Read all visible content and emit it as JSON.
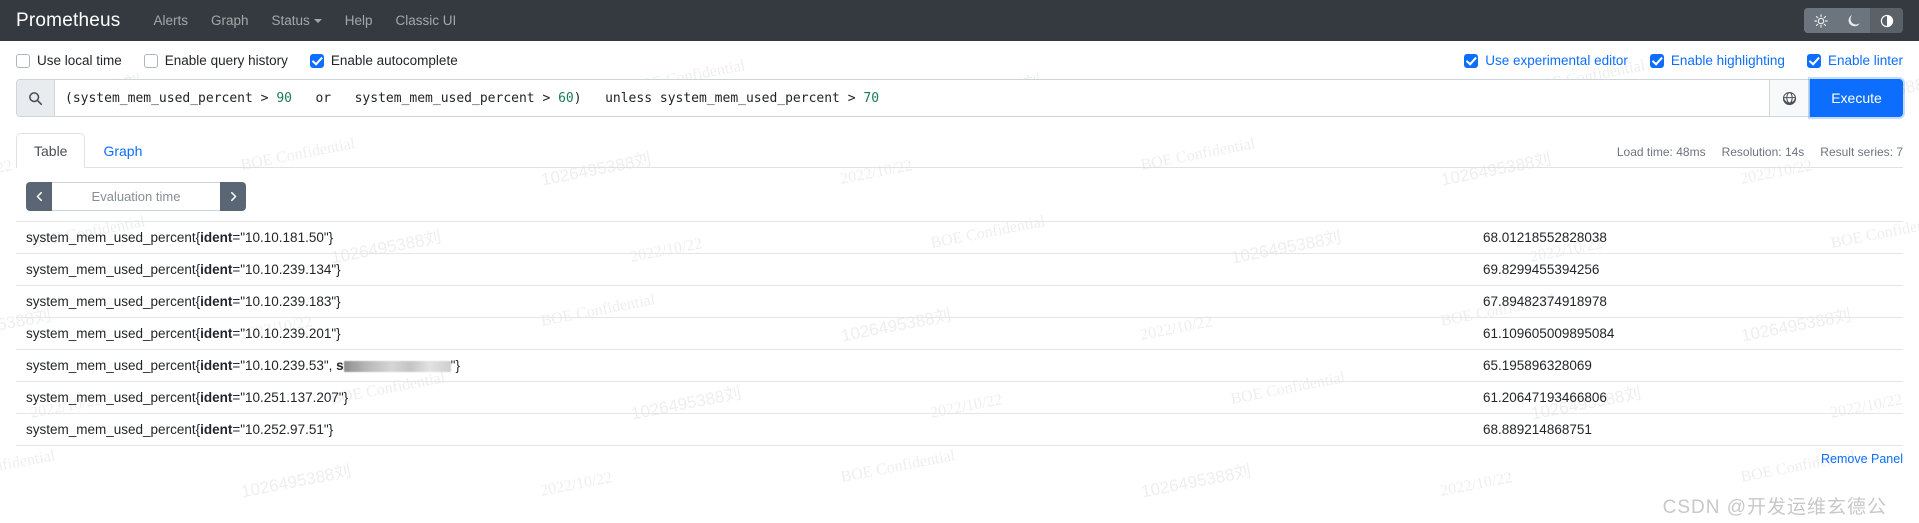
{
  "navbar": {
    "brand": "Prometheus",
    "links": [
      {
        "label": "Alerts",
        "has_caret": false
      },
      {
        "label": "Graph",
        "has_caret": false
      },
      {
        "label": "Status",
        "has_caret": true
      },
      {
        "label": "Help",
        "has_caret": false
      },
      {
        "label": "Classic UI",
        "has_caret": false
      }
    ],
    "theme_buttons": [
      {
        "name": "light-theme",
        "icon": "sun-icon",
        "active": false
      },
      {
        "name": "dark-theme",
        "icon": "moon-icon",
        "active": false
      },
      {
        "name": "auto-theme",
        "icon": "half-circle-icon",
        "active": true
      }
    ]
  },
  "options_left": [
    {
      "label": "Use local time",
      "checked": false
    },
    {
      "label": "Enable query history",
      "checked": false
    },
    {
      "label": "Enable autocomplete",
      "checked": true
    }
  ],
  "options_right": [
    {
      "label": "Use experimental editor",
      "checked": true
    },
    {
      "label": "Enable highlighting",
      "checked": true
    },
    {
      "label": "Enable linter",
      "checked": true
    }
  ],
  "query": {
    "icon": "search-icon",
    "globe_icon": "globe-icon",
    "execute_label": "Execute",
    "expression": "(system_mem_used_percent > 90  or  system_mem_used_percent > 60)  unless system_mem_used_percent > 70",
    "tokens": [
      {
        "text": "(system_mem_used_percent ",
        "type": "plain"
      },
      {
        "text": "> ",
        "type": "op"
      },
      {
        "text": "90",
        "type": "num"
      },
      {
        "text": "   or   ",
        "type": "kw"
      },
      {
        "text": "system_mem_used_percent ",
        "type": "plain"
      },
      {
        "text": "> ",
        "type": "op"
      },
      {
        "text": "60",
        "type": "num"
      },
      {
        "text": ")",
        "type": "plain"
      },
      {
        "text": "   unless ",
        "type": "kw"
      },
      {
        "text": "system_mem_used_percent ",
        "type": "plain"
      },
      {
        "text": "> ",
        "type": "op"
      },
      {
        "text": "70",
        "type": "num"
      }
    ]
  },
  "panel": {
    "tabs": [
      {
        "label": "Table",
        "active": true
      },
      {
        "label": "Graph",
        "active": false
      }
    ],
    "stats": {
      "load_time": "Load time: 48ms",
      "resolution": "Resolution: 14s",
      "result_series": "Result series: 7"
    },
    "evaluation_time": {
      "placeholder": "Evaluation time",
      "value": "",
      "prev_icon": "chevron-left-icon",
      "next_icon": "chevron-right-icon"
    },
    "remove_panel_label": "Remove Panel"
  },
  "results": {
    "metric_name": "system_mem_used_percent",
    "rows": [
      {
        "label_key": "ident",
        "label_value": "10.10.181.50",
        "extra": "",
        "redacted": false,
        "value": "68.01218552828038"
      },
      {
        "label_key": "ident",
        "label_value": "10.10.239.134",
        "extra": "",
        "redacted": false,
        "value": "69.8299455394256"
      },
      {
        "label_key": "ident",
        "label_value": "10.10.239.183",
        "extra": "",
        "redacted": false,
        "value": "67.89482374918978"
      },
      {
        "label_key": "ident",
        "label_value": "10.10.239.201",
        "extra": "",
        "redacted": false,
        "value": "61.109605009895084"
      },
      {
        "label_key": "ident",
        "label_value": "10.10.239.53",
        "extra": "s",
        "redacted": true,
        "value": "65.195896328069"
      },
      {
        "label_key": "ident",
        "label_value": "10.251.137.207",
        "extra": "",
        "redacted": false,
        "value": "61.20647193466806"
      },
      {
        "label_key": "ident",
        "label_value": "10.252.97.51",
        "extra": "",
        "redacted": false,
        "value": "68.889214868751"
      }
    ]
  },
  "watermarks": {
    "csdn": "CSDN @开发运维玄德公",
    "texts": [
      "BOE Confidential",
      "1026495388刘",
      "2022/10/22"
    ]
  },
  "colors": {
    "navbar_bg": "#343a40",
    "accent": "#0d6efd",
    "number_token": "#1c7c54",
    "eval_btn": "#5a6673"
  }
}
